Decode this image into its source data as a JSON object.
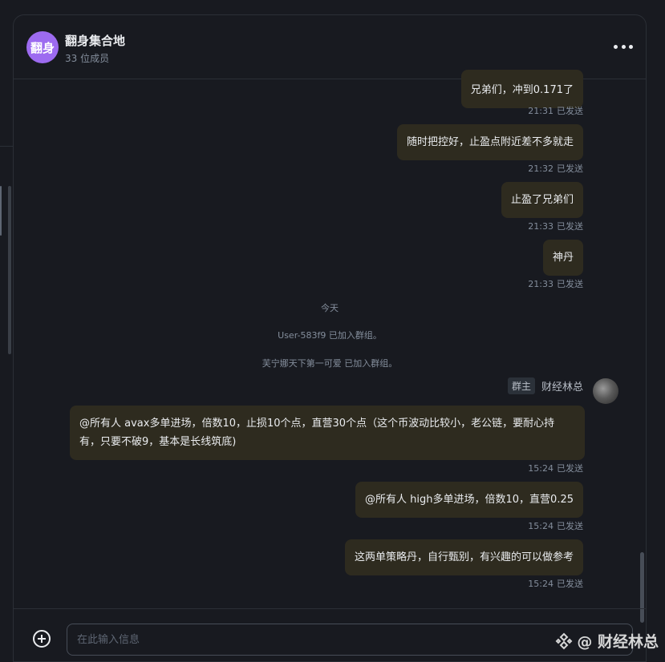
{
  "header": {
    "avatar_text": "翻身",
    "group_name": "翻身集合地",
    "member_count": "33 位成员",
    "more_icon": "more-horizontal-icon"
  },
  "messages": [
    {
      "text": "兄弟们，冲到0.171了",
      "time": "21:31",
      "status": "已发送"
    },
    {
      "text": "随时把控好，止盈点附近差不多就走",
      "time": "21:32",
      "status": "已发送"
    },
    {
      "text": "止盈了兄弟们",
      "time": "21:33",
      "status": "已发送"
    },
    {
      "text": "神丹",
      "time": "21:33",
      "status": "已发送"
    },
    {
      "text": "@所有人 avax多单进场，倍数10，止损10个点，直营30个点（这个币波动比较小，老公链，要耐心持有，只要不破9，基本是长线筑底)",
      "time": "15:24",
      "status": "已发送"
    },
    {
      "text": "@所有人 high多单进场，倍数10，直营0.25",
      "time": "15:24",
      "status": "已发送"
    },
    {
      "text": "这两单策略丹，自行甄别，有兴趣的可以做参考",
      "time": "15:24",
      "status": "已发送"
    }
  ],
  "system": {
    "date_divider": "今天",
    "join1": "User-583f9 已加入群组。",
    "join2": "芙宁娜天下第一可爱 已加入群组。"
  },
  "sender": {
    "role": "群主",
    "name": "财经林总"
  },
  "composer": {
    "placeholder": "在此输入信息",
    "attach_icon": "plus-circle-icon"
  },
  "watermark": {
    "text": "@ 财经林总",
    "icon": "binance-icon"
  },
  "colors": {
    "background": "#181a20",
    "bubble": "#2e2b1f",
    "avatar": "#9d6bf0",
    "muted_text": "#848e9c",
    "border": "#2b2f36"
  }
}
